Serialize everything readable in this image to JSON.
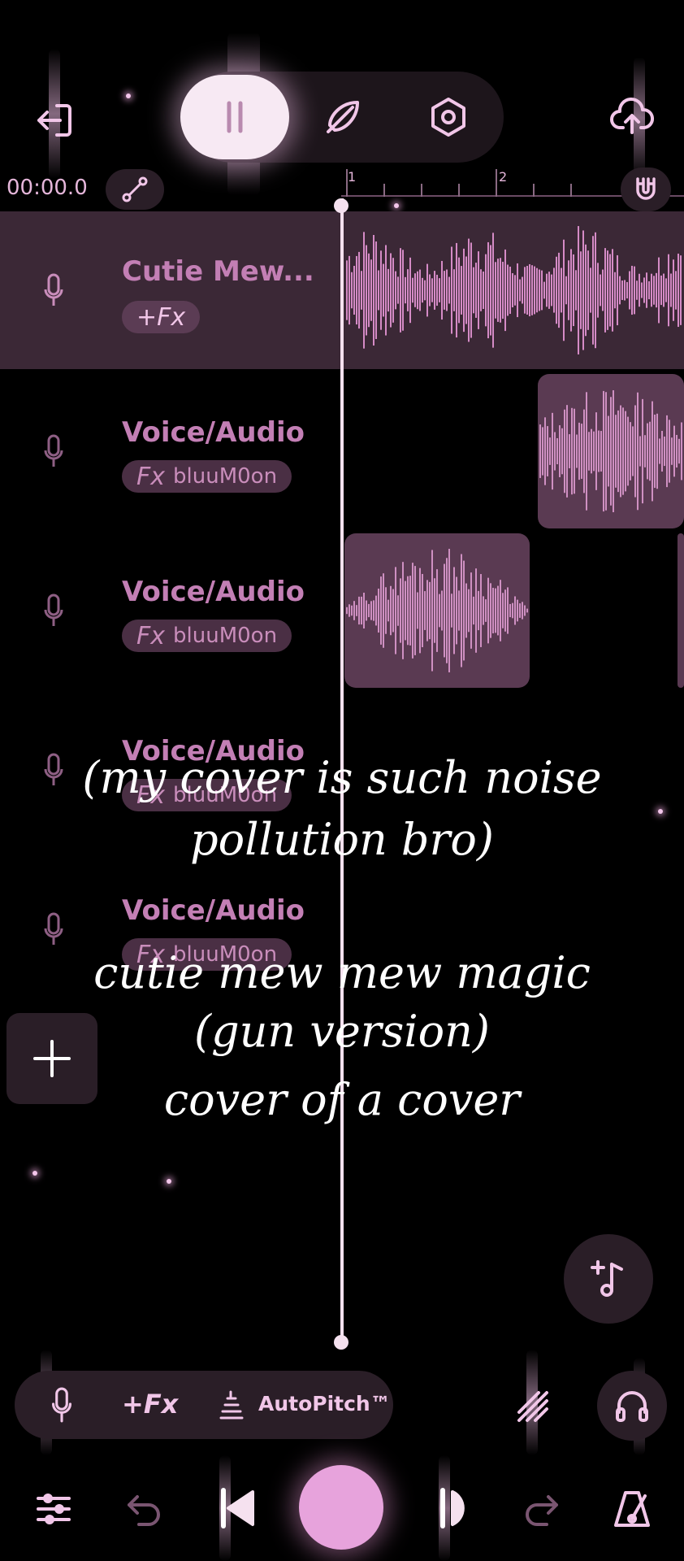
{
  "timeline": {
    "time": "00:00.0",
    "ruler_marks": [
      "1",
      "2"
    ]
  },
  "tracks": [
    {
      "title": "Cutie Mew...",
      "fx_prefix": "+Fx",
      "fx_name": "",
      "active": true
    },
    {
      "title": "Voice/Audio",
      "fx_prefix": "Fx",
      "fx_name": "bluuM0on",
      "active": false
    },
    {
      "title": "Voice/Audio",
      "fx_prefix": "Fx",
      "fx_name": "bluuM0on",
      "active": false
    },
    {
      "title": "Voice/Audio",
      "fx_prefix": "Fx",
      "fx_name": "bluuM0on",
      "active": false
    },
    {
      "title": "Voice/Audio",
      "fx_prefix": "Fx",
      "fx_name": "bluuM0on",
      "active": false
    }
  ],
  "caption": {
    "lines": [
      "(my cover is such noise",
      "pollution bro)",
      "",
      "cutie mew mew magic",
      "(gun version)",
      "cover of a cover"
    ]
  },
  "toolbar": {
    "fx_label": "+Fx",
    "autopitch_label": "AutoPitch™"
  },
  "icons": {
    "exit": "exit-icon",
    "mode_tracks": "tracks-mode-icon",
    "mode_feather": "feather-icon",
    "settings": "settings-hex-icon",
    "upload": "cloud-upload-icon",
    "link": "link-icon",
    "magnet": "magnet-icon",
    "mic": "mic-icon",
    "add": "plus-icon",
    "add_music": "add-music-icon",
    "tune": "tuning-fork-icon",
    "headphones": "headphones-icon",
    "mixer": "mixer-sliders-icon",
    "undo": "undo-icon",
    "skip_back": "skip-back-icon",
    "record": "record-icon",
    "play": "play-icon",
    "redo": "redo-icon",
    "metronome": "metronome-icon"
  },
  "colors": {
    "accent": "#e7a3dc",
    "track_title": "#c37fb5",
    "background": "#000000"
  }
}
